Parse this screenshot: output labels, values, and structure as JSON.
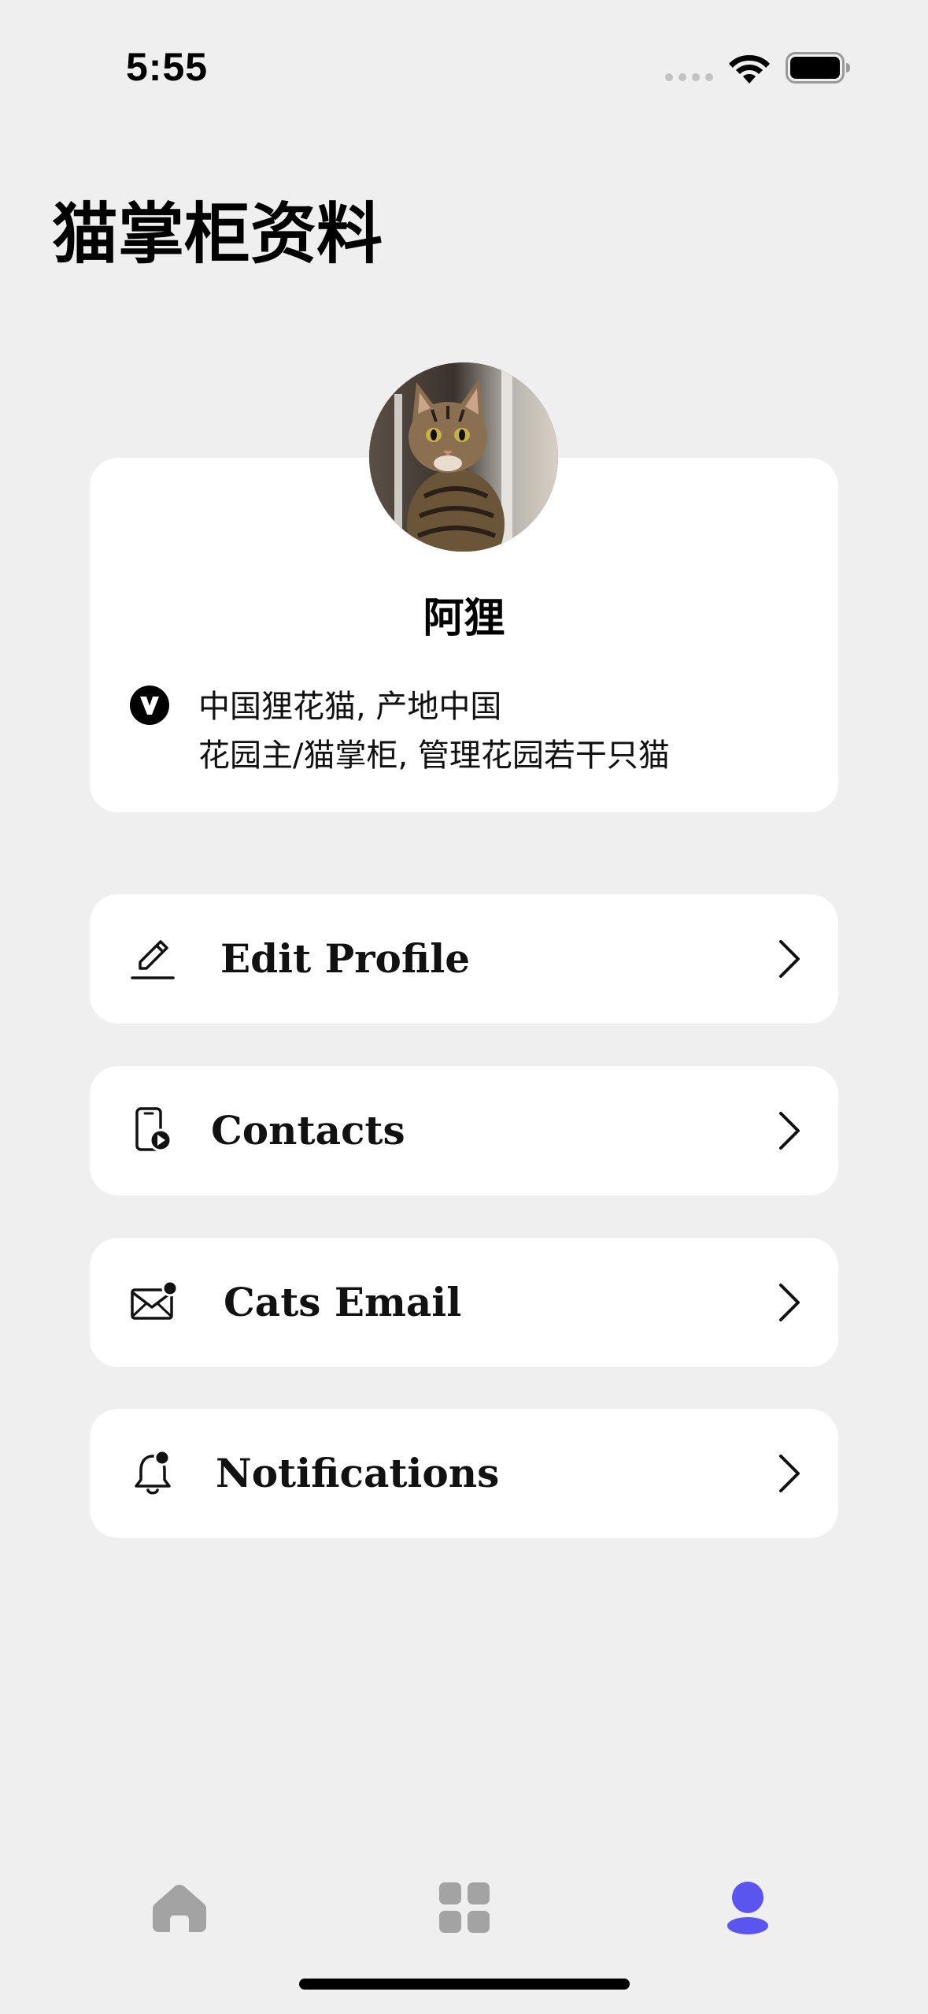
{
  "status_bar": {
    "time": "5:55"
  },
  "page": {
    "title": "猫掌柜资料"
  },
  "profile": {
    "name": "阿狸",
    "bio_line1": "中国狸花猫, 产地中国",
    "bio_line2": "花园主/猫掌柜, 管理花园若干只猫",
    "avatar_icon": "cat-photo",
    "verified_icon": "verified-badge-icon"
  },
  "menu": [
    {
      "label": "Edit Profile",
      "icon": "pencil-icon"
    },
    {
      "label": "Contacts",
      "icon": "phone-video-icon"
    },
    {
      "label": "Cats Email",
      "icon": "mail-icon"
    },
    {
      "label": "Notifications",
      "icon": "bell-icon"
    }
  ],
  "tab_bar": {
    "tabs": [
      {
        "name": "home",
        "icon": "home-icon",
        "active": false
      },
      {
        "name": "grid",
        "icon": "grid-icon",
        "active": false
      },
      {
        "name": "profile",
        "icon": "person-icon",
        "active": true
      }
    ],
    "active_color": "#5b55f0",
    "inactive_color": "#a3a3a3"
  }
}
